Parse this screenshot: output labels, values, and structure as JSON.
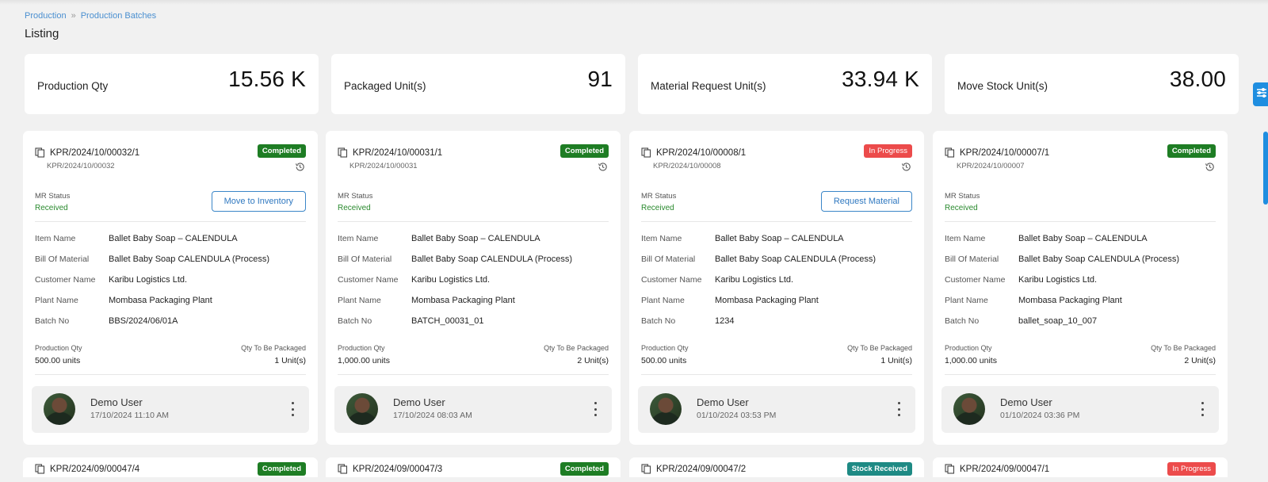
{
  "breadcrumb": {
    "root": "Production",
    "current": "Production Batches"
  },
  "page": {
    "title": "Listing"
  },
  "stats": [
    {
      "label": "Production Qty",
      "value": "15.56 K"
    },
    {
      "label": "Packaged Unit(s)",
      "value": "91"
    },
    {
      "label": "Material Request Unit(s)",
      "value": "33.94 K"
    },
    {
      "label": "Move Stock Unit(s)",
      "value": "38.00"
    }
  ],
  "labels": {
    "mr_status": "MR Status",
    "item_name": "Item Name",
    "bill_of_material": "Bill Of Material",
    "customer_name": "Customer Name",
    "plant_name": "Plant Name",
    "batch_no": "Batch No",
    "production_qty": "Production Qty",
    "qty_to_be_packaged": "Qty To Be Packaged"
  },
  "cards": [
    {
      "code": "KPR/2024/10/00032/1",
      "subcode": "KPR/2024/10/00032",
      "status": "Completed",
      "status_color": "#1e7d24",
      "mr_status": "Received",
      "action": "Move to Inventory",
      "item_name": "Ballet Baby Soap – CALENDULA",
      "bill_of_material": "Ballet Baby Soap CALENDULA (Process)",
      "customer_name": "Karibu Logistics Ltd.",
      "plant_name": "Mombasa Packaging Plant",
      "batch_no": "BBS/2024/06/01A",
      "production_qty": "500.00 units",
      "qty_to_be_packaged": "1 Unit(s)",
      "user": "Demo User",
      "time": "17/10/2024 11:10 AM"
    },
    {
      "code": "KPR/2024/10/00031/1",
      "subcode": "KPR/2024/10/00031",
      "status": "Completed",
      "status_color": "#1e7d24",
      "mr_status": "Received",
      "action": "",
      "item_name": "Ballet Baby Soap – CALENDULA",
      "bill_of_material": "Ballet Baby Soap CALENDULA (Process)",
      "customer_name": "Karibu Logistics Ltd.",
      "plant_name": "Mombasa Packaging Plant",
      "batch_no": "BATCH_00031_01",
      "production_qty": "1,000.00 units",
      "qty_to_be_packaged": "2 Unit(s)",
      "user": "Demo User",
      "time": "17/10/2024 08:03 AM"
    },
    {
      "code": "KPR/2024/10/00008/1",
      "subcode": "KPR/2024/10/00008",
      "status": "In Progress",
      "status_color": "#ec4b4b",
      "mr_status": "Received",
      "action": "Request Material",
      "item_name": "Ballet Baby Soap – CALENDULA",
      "bill_of_material": "Ballet Baby Soap CALENDULA (Process)",
      "customer_name": "Karibu Logistics Ltd.",
      "plant_name": "Mombasa Packaging Plant",
      "batch_no": "1234",
      "production_qty": "500.00 units",
      "qty_to_be_packaged": "1 Unit(s)",
      "user": "Demo User",
      "time": "01/10/2024 03:53 PM"
    },
    {
      "code": "KPR/2024/10/00007/1",
      "subcode": "KPR/2024/10/00007",
      "status": "Completed",
      "status_color": "#1e7d24",
      "mr_status": "Received",
      "action": "",
      "item_name": "Ballet Baby Soap – CALENDULA",
      "bill_of_material": "Ballet Baby Soap CALENDULA (Process)",
      "customer_name": "Karibu Logistics Ltd.",
      "plant_name": "Mombasa Packaging Plant",
      "batch_no": "ballet_soap_10_007",
      "production_qty": "1,000.00 units",
      "qty_to_be_packaged": "2 Unit(s)",
      "user": "Demo User",
      "time": "01/10/2024 03:36 PM"
    }
  ],
  "cards_row2": [
    {
      "code": "KPR/2024/09/00047/4",
      "status": "Completed",
      "status_color": "#1e7d24"
    },
    {
      "code": "KPR/2024/09/00047/3",
      "status": "Completed",
      "status_color": "#1e7d24"
    },
    {
      "code": "KPR/2024/09/00047/2",
      "status": "Stock Received",
      "status_color": "#1e8a84"
    },
    {
      "code": "KPR/2024/09/00047/1",
      "status": "In Progress",
      "status_color": "#ec4b4b"
    }
  ]
}
